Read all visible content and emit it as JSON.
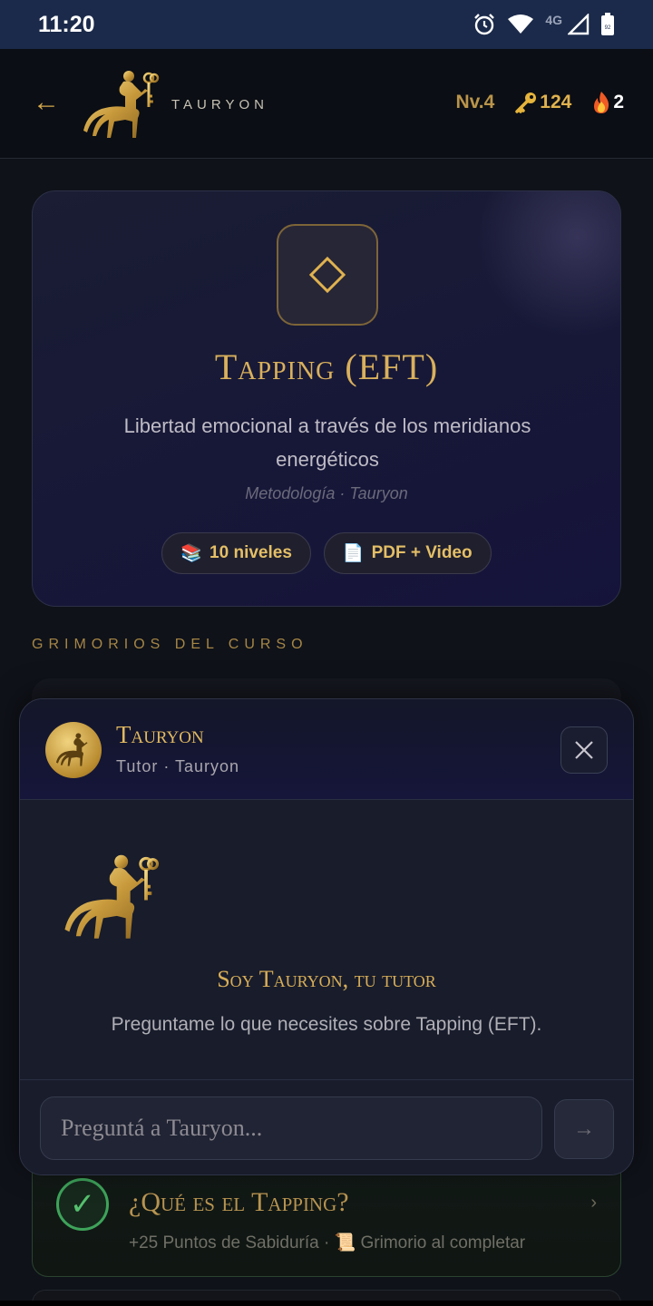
{
  "status_bar": {
    "time": "11:20",
    "network": "4G",
    "battery": "92"
  },
  "header": {
    "back_symbol": "←",
    "brand": "TAURYON",
    "level": "Nv.4",
    "keys": "124",
    "streak": "2",
    "key_icon": "key-icon",
    "streak_icon": "fire-icon"
  },
  "course": {
    "icon": "diamond-icon",
    "title": "Tapping (EFT)",
    "description": "Libertad emocional a través de los meridianos energéticos",
    "meta": "Metodología · Tauryon",
    "badges": [
      {
        "emoji": "📚",
        "label": "10 niveles"
      },
      {
        "emoji": "📄",
        "label": "PDF + Video"
      }
    ]
  },
  "section_label": "GRIMORIOS DEL CURSO",
  "lesson": {
    "check": "✓",
    "title": "¿Qué es el Tapping?",
    "points": "+25 Puntos de Sabiduría · ",
    "scroll_emoji": "📜",
    "reward": "Grimorio al completar",
    "chevron": "›"
  },
  "chat": {
    "name": "Tauryon",
    "role": "Tutor · Tauryon",
    "greeting": "Soy Tauryon, tu tutor",
    "hint": "Preguntame lo que necesites sobre Tapping (EFT).",
    "input_placeholder": "Preguntá a Tauryon...",
    "send_symbol": "→"
  },
  "colors": {
    "gold": "#d9b05c",
    "background": "#0f1219",
    "status_bar": "#1b2a4a",
    "success": "#3ea35a"
  }
}
